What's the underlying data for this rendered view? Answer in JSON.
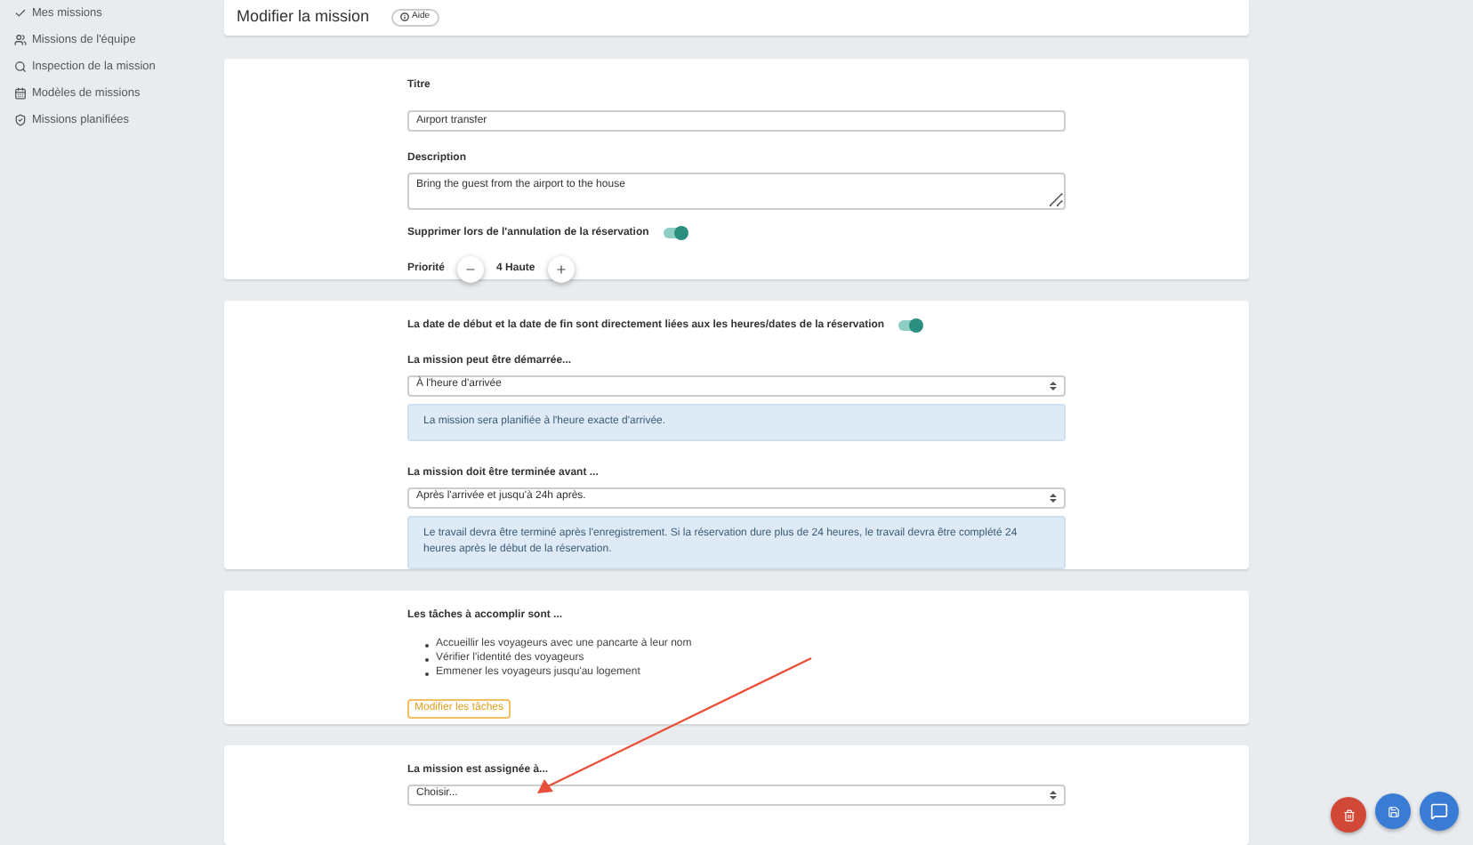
{
  "sidebar": {
    "items": [
      {
        "label": "Mes missions"
      },
      {
        "label": "Missions de l'équipe"
      },
      {
        "label": "Inspection de la mission"
      },
      {
        "label": "Modèles de missions"
      },
      {
        "label": "Missions planifiées"
      }
    ]
  },
  "header": {
    "title": "Modifier la mission",
    "help_button": "Aide"
  },
  "general": {
    "title_label": "Titre",
    "title_value": "Airport transfer",
    "description_label": "Description",
    "description_value": "Bring the guest from the airport to the house",
    "delete_toggle": {
      "label": "Supprimer lors de l'annulation de la réservation",
      "on": true
    },
    "priority_label": "Priorité",
    "priority_value": "4 Haute"
  },
  "schedule": {
    "linked_toggle": {
      "label": "La date de début et la date de fin sont directement liées aux les heures/dates de la réservation",
      "on": true
    },
    "start": {
      "label": "La mission peut être démarrée...",
      "value": "À l'heure d'arrivée",
      "info": "La mission sera planifiée à l'heure exacte d'arrivée."
    },
    "end": {
      "label": "La mission doit être terminée avant ...",
      "value": "Après l'arrivée et jusqu'à 24h après.",
      "info": "Le travail devra être terminé après l'enregistrement. Si la réservation dure plus de 24 heures, le travail devra être complété 24 heures après le début de la réservation."
    }
  },
  "tasks": {
    "label": "Les tâches à accomplir sont ...",
    "items": [
      "Accueillir les voyageurs avec une pancarte à leur nom",
      "Vérifier l'identité des voyageurs",
      "Emmener les voyageurs jusqu'au logement"
    ],
    "edit_button": "Modifier les tâches"
  },
  "assignment": {
    "label": "La mission est assignée à...",
    "value": "Choisir..."
  }
}
